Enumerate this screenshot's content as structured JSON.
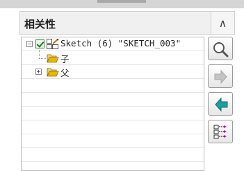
{
  "panel": {
    "title": "相关性",
    "collapse_glyph": "∧"
  },
  "tree": {
    "root": {
      "expander": "−",
      "label": "Sketch (6) \"SKETCH_003\"",
      "icons": [
        "checkbox-checked-icon",
        "sketch-icon"
      ]
    },
    "children": [
      {
        "label": "子",
        "icon": "folder-open-icon",
        "expander": ""
      },
      {
        "label": "父",
        "icon": "folder-open-icon",
        "expander": "+"
      }
    ]
  },
  "toolbar": {
    "buttons": [
      {
        "name": "search-icon",
        "enabled": true
      },
      {
        "name": "arrow-right-icon",
        "enabled": false
      },
      {
        "name": "arrow-left-icon",
        "enabled": true
      },
      {
        "name": "tree-view-icon",
        "enabled": true
      }
    ]
  },
  "colors": {
    "header_bg": "#f0f0f0",
    "arrow_left": "#1aa0a0",
    "arrow_disabled": "#b8b8b8",
    "folder": "#e8b800",
    "check_green": "#1d7a1d"
  }
}
